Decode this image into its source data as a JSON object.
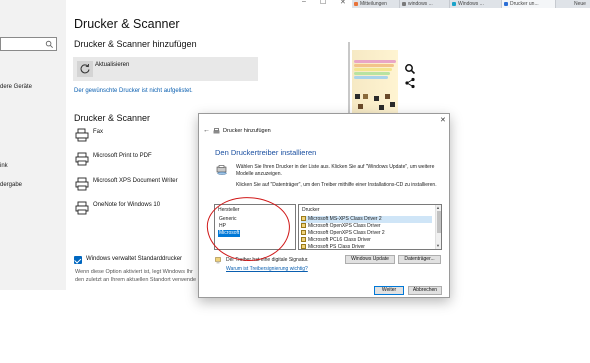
{
  "browser": {
    "tabs": [
      {
        "label": "Mitteilungen",
        "color": "#e8733a"
      },
      {
        "label": "windows ...",
        "color": "#7a7a7a"
      },
      {
        "label": "Windows ...",
        "color": "#1aa3c9"
      },
      {
        "label": "Drucker un...",
        "color": "#2c6fd6"
      },
      {
        "label": "Neue",
        "color": "#dfe3e8"
      }
    ]
  },
  "settings": {
    "sidebar": {
      "items": [
        "dere Geräte",
        "ink",
        "dergabe"
      ]
    },
    "window_controls": {
      "minimize": "–",
      "maximize": "☐",
      "close": "✕"
    },
    "title": "Drucker & Scanner",
    "add_heading": "Drucker & Scanner hinzufügen",
    "refresh_label": "Aktualisieren",
    "printer_not_listed": "Der gewünschte Drucker ist nicht aufgelistet.",
    "list_heading": "Drucker & Scanner",
    "printers": [
      {
        "name": "Fax",
        "icon": "fax-icon"
      },
      {
        "name": "Microsoft Print to PDF",
        "icon": "printer-icon"
      },
      {
        "name": "Microsoft XPS Document Writer",
        "icon": "printer-icon"
      },
      {
        "name": "OneNote for Windows 10",
        "icon": "printer-icon"
      }
    ],
    "default_checkbox_label": "Windows verwaltet Standarddrucker",
    "default_checkbox_checked": true,
    "default_desc_line1": "Wenn diese Option aktiviert ist, legt Windows Ihr",
    "default_desc_line2": "den zuletzt an Ihrem aktuellen Standort verwende"
  },
  "dialog": {
    "close": "✕",
    "back": "←",
    "title": "Drucker hinzufügen",
    "heading": "Den Druckertreiber installieren",
    "description1": "Wählen Sie Ihren Drucker in der Liste aus. Klicken Sie auf \"Windows Update\", um weitere Modelle anzuzeigen.",
    "description2": "Klicken Sie auf \"Datenträger\", um den Treiber mithilfe einer Installations-CD zu installieren.",
    "manufacturer_header": "Hersteller",
    "manufacturers": [
      {
        "name": "Generic",
        "selected": false
      },
      {
        "name": "HP",
        "selected": false
      },
      {
        "name": "Microsoft",
        "selected": true
      }
    ],
    "printer_header": "Drucker",
    "printer_models": [
      {
        "name": "Microsoft MS-XPS Class Driver 2",
        "selected": true
      },
      {
        "name": "Microsoft OpenXPS Class Driver",
        "selected": false
      },
      {
        "name": "Microsoft OpenXPS Class Driver 2",
        "selected": false
      },
      {
        "name": "Microsoft PCL6 Class Driver",
        "selected": false
      },
      {
        "name": "Microsoft PS Class Driver",
        "selected": false
      }
    ],
    "signed_label": "Der Treiber hat eine digitale Signatur.",
    "signing_link": "Warum ist Treibersignierung wichtig?",
    "btn_windows_update": "Windows Update",
    "btn_datentraeger": "Datenträger...",
    "btn_weiter": "Weiter",
    "btn_abbrechen": "Abbrechen"
  },
  "colors": {
    "accent": "#0078d7",
    "link": "#0a5fb0",
    "heading_blue": "#1a4fa0",
    "annotation_red": "#d01818"
  }
}
